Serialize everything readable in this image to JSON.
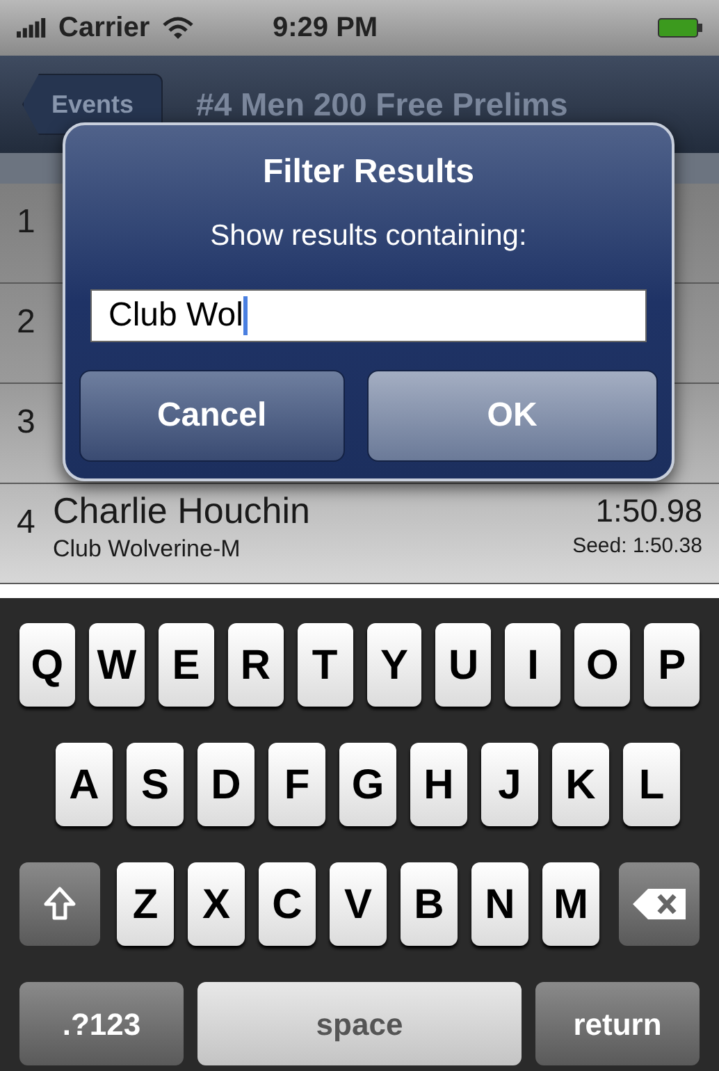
{
  "status_bar": {
    "carrier": "Carrier",
    "time": "9:29 PM"
  },
  "nav_bar": {
    "back": "Events",
    "title": "#4 Men 200 Free Prelims"
  },
  "results": [
    {
      "place": "1"
    },
    {
      "place": "2"
    },
    {
      "place": "3"
    },
    {
      "place": "4",
      "name": "Charlie Houchin",
      "team": "Club Wolverine-M",
      "time": "1:50.98",
      "seed": "Seed: 1:50.38"
    }
  ],
  "dialog": {
    "title": "Filter Results",
    "message": "Show results containing:",
    "value": "Club Wol",
    "buttons": [
      {
        "label": "Cancel",
        "kind": "cancel"
      },
      {
        "label": "OK",
        "kind": "ok"
      }
    ]
  },
  "keyboard": {
    "rows": [
      [
        "Q",
        "W",
        "E",
        "R",
        "T",
        "Y",
        "U",
        "I",
        "O",
        "P"
      ],
      [
        "A",
        "S",
        "D",
        "F",
        "G",
        "H",
        "J",
        "K",
        "L"
      ],
      [
        "Z",
        "X",
        "C",
        "V",
        "B",
        "N",
        "M"
      ]
    ],
    "numbers": ".?123",
    "space": "space",
    "return": "return"
  }
}
